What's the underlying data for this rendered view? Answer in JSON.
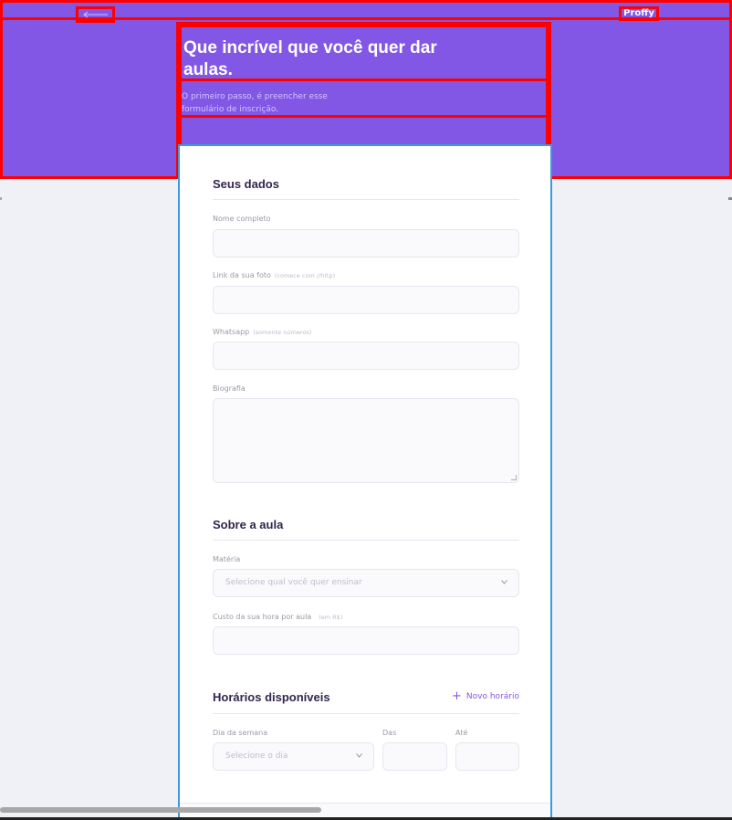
{
  "header": {
    "brand": "Proffy",
    "title": "Que incrível que você quer dar aulas.",
    "subtitle": "O primeiro passo, é preencher esse formulário de inscrição."
  },
  "sections": {
    "personal": {
      "title": "Seus dados",
      "name_label": "Nome completo",
      "photo_label": "Link da sua foto",
      "photo_hint": "(comece com //http)",
      "whatsapp_label": "Whatsapp",
      "whatsapp_hint": "(somente números)",
      "bio_label": "Biografia"
    },
    "class": {
      "title": "Sobre a aula",
      "subject_label": "Matéria",
      "subject_placeholder": "Selecione qual você quer ensinar",
      "cost_label": "Custo da sua hora por aula",
      "cost_hint": "(em R$)"
    },
    "schedule": {
      "title": "Horários disponíveis",
      "add_label": "Novo horário",
      "weekday_label": "Dia da semana",
      "weekday_placeholder": "Selecione o dia",
      "from_label": "Das",
      "to_label": "Até"
    }
  },
  "colors": {
    "primary": "#8257e5",
    "annotation_outline": "#ff0000",
    "card_border": "#3a9bdc"
  },
  "icons": {
    "back": "arrow-left-icon",
    "add": "plus-icon",
    "select": "chevron-down-icon"
  }
}
